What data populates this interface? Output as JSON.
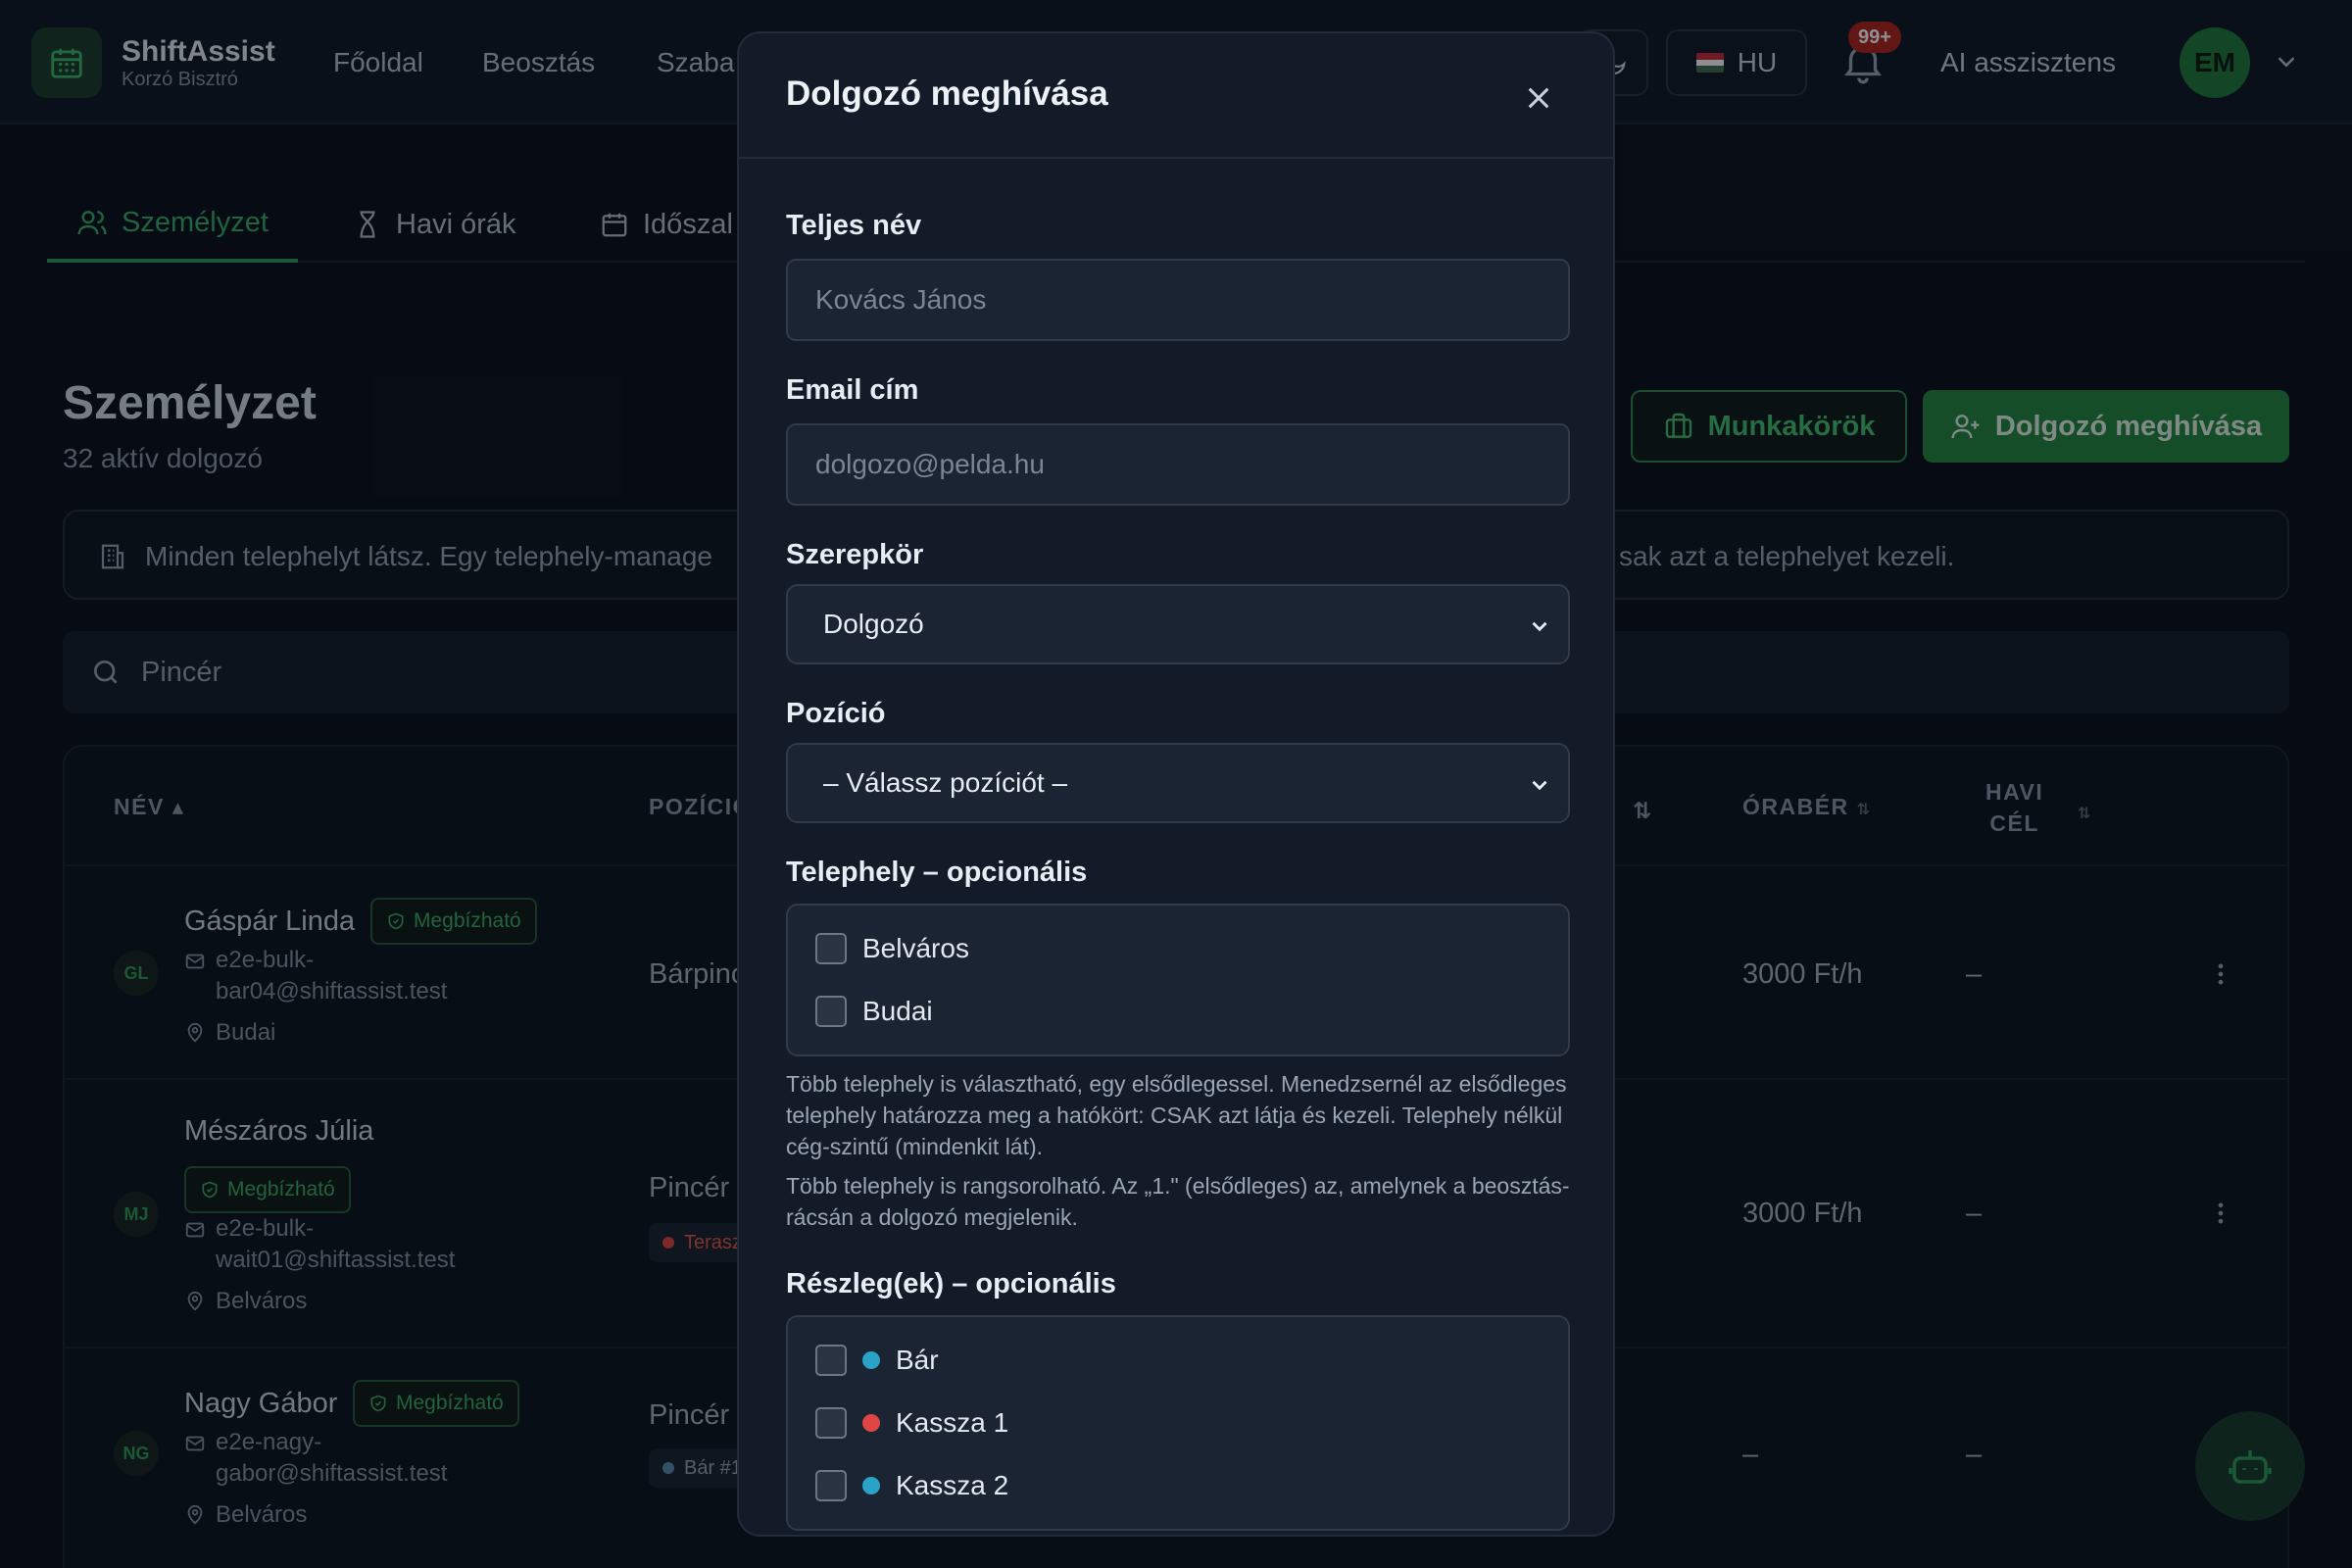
{
  "brand": {
    "name": "ShiftAssist",
    "subtitle": "Korzó Bisztró"
  },
  "nav": {
    "items": [
      "Főoldal",
      "Beosztás",
      "Szaba"
    ]
  },
  "topbar": {
    "language": "HU",
    "notification_count": "99+",
    "ai_label": "AI asszisztens",
    "user_initials": "EM"
  },
  "tabs": [
    {
      "label": "Személyzet",
      "icon": "users-icon",
      "active": true
    },
    {
      "label": "Havi órák",
      "icon": "hourglass-icon",
      "active": false
    },
    {
      "label": "Időszal",
      "icon": "calendar-icon",
      "active": false
    }
  ],
  "page": {
    "title": "Személyzet",
    "subtitle": "32 aktív dolgozó",
    "roles_button": "Munkakörök",
    "invite_button": "Dolgozó meghívása",
    "banner_left": "Minden telephelyt látsz. Egy telephely-manage",
    "banner_right": "sak azt a telephelyet kezeli.",
    "search_value": "Pincér"
  },
  "table": {
    "headers": {
      "name": "NÉV ▴",
      "position": "POZÍCIÓ",
      "hidden_sort": "⇅",
      "rate": "ÓRABÉR",
      "goal_line1": "HAVI",
      "goal_line2": "CÉL"
    },
    "rows": [
      {
        "initials": "GL",
        "name": "Gáspár Linda",
        "badge": "Megbízható",
        "email_1": "e2e-bulk-",
        "email_2": "bar04@shiftassist.test",
        "location": "Budai",
        "position": "Bárpinc",
        "tag": "",
        "rate": "3000 Ft/h",
        "goal": "–"
      },
      {
        "initials": "MJ",
        "name": "Mészáros Júlia",
        "badge": "Megbízható",
        "email_1": "e2e-bulk-",
        "email_2": "wait01@shiftassist.test",
        "location": "Belváros",
        "position": "Pincér",
        "tag": "Terasz",
        "rate": "3000 Ft/h",
        "goal": "–"
      },
      {
        "initials": "NG",
        "name": "Nagy Gábor",
        "badge": "Megbízható",
        "email_1": "e2e-nagy-",
        "email_2": "gabor@shiftassist.test",
        "location": "Belváros",
        "position": "Pincér",
        "tag": "Bár #1",
        "rate": "–",
        "goal": "–"
      }
    ]
  },
  "modal": {
    "title": "Dolgozó meghívása",
    "name_label": "Teljes név",
    "name_placeholder": "Kovács János",
    "email_label": "Email cím",
    "email_placeholder": "dolgozo@pelda.hu",
    "role_label": "Szerepkör",
    "role_value": "Dolgozó",
    "position_label": "Pozíció",
    "position_value": "– Válassz pozíciót –",
    "site_label": "Telephely – opcionális",
    "sites": [
      "Belváros",
      "Budai"
    ],
    "site_help_1": "Több telephely is választható, egy elsődlegessel. Menedzsernél az elsődleges telephely határozza meg a hatókört: CSAK azt látja és kezeli. Telephely nélkül cég-szintű (mindenkit lát).",
    "site_help_2": "Több telephely is rangsorolható. Az „1.\" (elsődleges) az, amelynek a beosztás-rácsán a dolgozó megjelenik.",
    "dept_label": "Részleg(ek) – opcionális",
    "departments": [
      {
        "name": "Bár",
        "color": "#2aa3c9"
      },
      {
        "name": "Kassza 1",
        "color": "#e04545"
      },
      {
        "name": "Kassza 2",
        "color": "#2aa3c9"
      }
    ]
  },
  "colors": {
    "accent": "#2e9b59",
    "primary_button": "#24883f",
    "background": "#0b111c",
    "modal": "#131b28"
  }
}
